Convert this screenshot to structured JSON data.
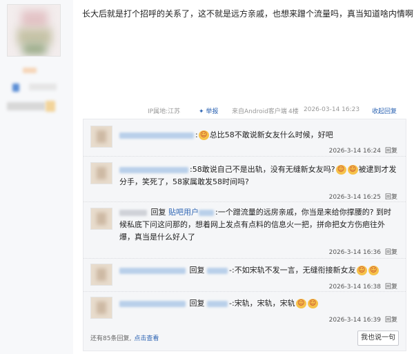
{
  "post": {
    "text": "长大后就是打个招呼的关系了，这不就是远方亲戚，也想来蹭个流量吗，真当知道啥内情啊",
    "meta": {
      "ip": "IP属地:江苏",
      "report": "举报",
      "source": "来自Android客户端",
      "floor": "4楼",
      "time": "2026-03-14 16:23",
      "toggle": "收起回复"
    }
  },
  "replies": [
    {
      "mention": "",
      "text": "总比58不敢说新女友什么时候，好吧",
      "trail": "",
      "time": "2026-3-14 16:24",
      "action": "回复"
    },
    {
      "mention": "",
      "text": "58敢说自己不是出轨，没有无缝新女友吗?",
      "trail": "被逮到才发分手，笑死了，58家属敢发58时间吗?",
      "time": "2026-3-14 16:25",
      "action": "回复"
    },
    {
      "prefix": "回复",
      "mention": "贴吧用户",
      "text": "一个蹭流量的远房亲戚，你当是来给你撑腰的? 到时候私底下问这问那的，想着网上发点有点料的信息火一把，拼命把女方伤疤往外爆，真当是什么好人了",
      "trail": "",
      "time": "2026-3-14 16:36",
      "action": "回复"
    },
    {
      "prefix": "回复",
      "mention": "",
      "text": "不如宋轨不发一言，无缝衔接新女友",
      "trail": "",
      "time": "2026-3-14 16:38",
      "action": "回复"
    },
    {
      "prefix": "回复",
      "mention": "",
      "text": "宋轨，宋轨，宋轨",
      "trail": "",
      "time": "2026-3-14 16:39",
      "action": "回复"
    }
  ],
  "more": {
    "count_text": "还有85条回复,",
    "view_link": "点击查看"
  },
  "say_button": "我也说一句",
  "colors": {
    "link": "#2d64b3",
    "reply_bg": "#f5f6f8",
    "emoji": "#f6c24a"
  }
}
